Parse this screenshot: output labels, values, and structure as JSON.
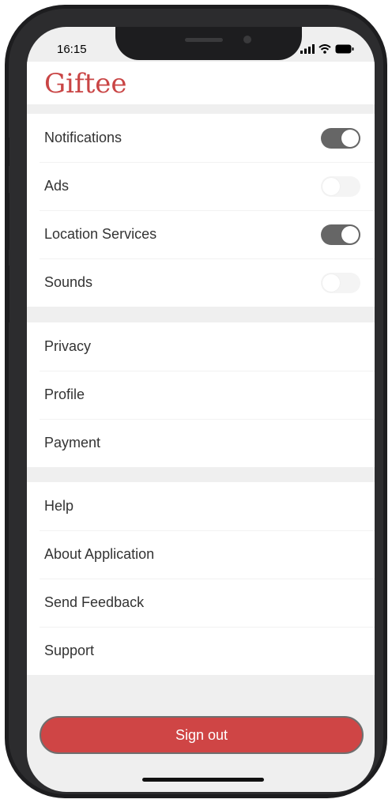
{
  "status_bar": {
    "time": "16:15"
  },
  "app": {
    "title": "Giftee"
  },
  "toggles": [
    {
      "label": "Notifications",
      "enabled": true
    },
    {
      "label": "Ads",
      "enabled": false
    },
    {
      "label": "Location Services",
      "enabled": true
    },
    {
      "label": "Sounds",
      "enabled": false
    }
  ],
  "account_items": [
    {
      "label": "Privacy"
    },
    {
      "label": "Profile"
    },
    {
      "label": "Payment"
    }
  ],
  "support_items": [
    {
      "label": "Help"
    },
    {
      "label": "About Application"
    },
    {
      "label": "Send Feedback"
    },
    {
      "label": "Support"
    }
  ],
  "sign_out": {
    "label": "Sign out"
  },
  "colors": {
    "brand": "#c94545",
    "button": "#cf4545",
    "toggle_on": "#666666",
    "toggle_off": "#f4f4f4"
  }
}
